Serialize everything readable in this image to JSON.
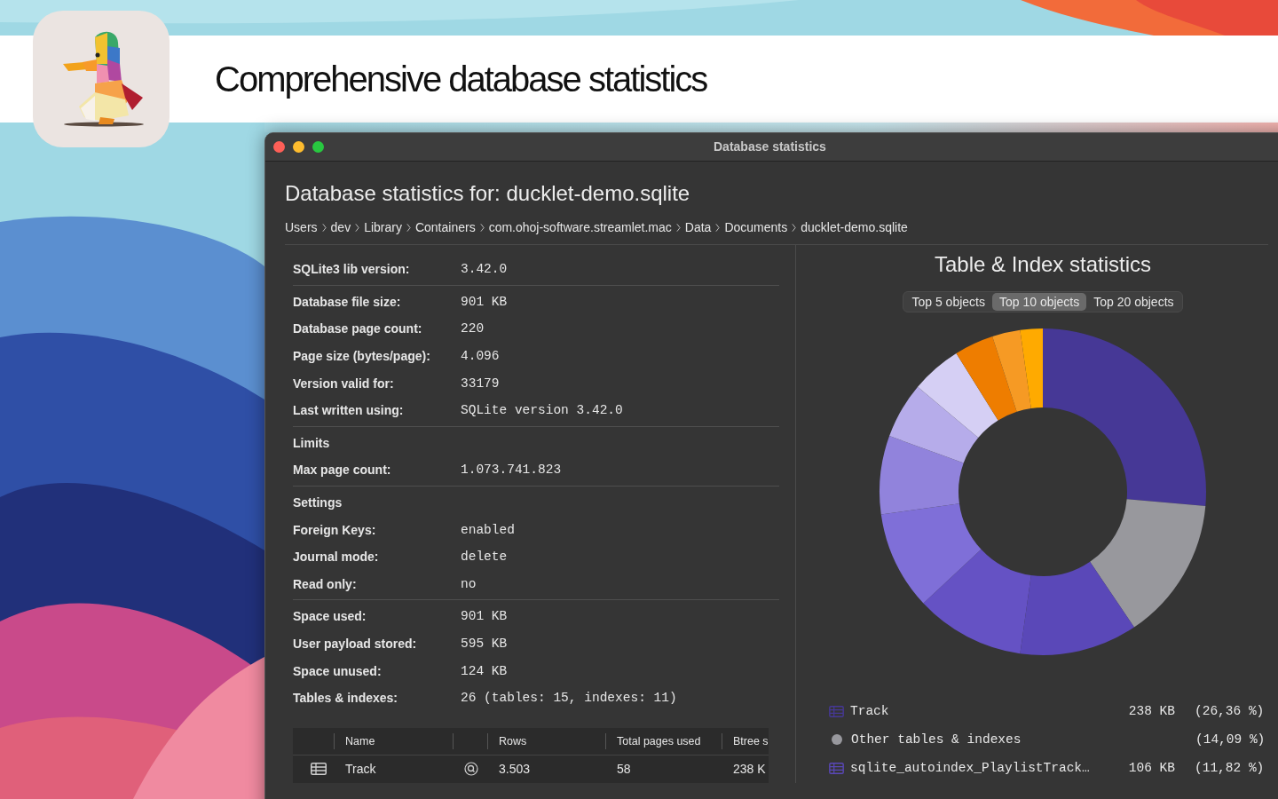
{
  "headline": "Comprehensive database statistics",
  "window": {
    "title": "Database statistics"
  },
  "heading": "Database statistics for: ducklet-demo.sqlite",
  "breadcrumb": [
    "Users",
    "dev",
    "Library",
    "Containers",
    "com.ohoj-software.streamlet.mac",
    "Data",
    "Documents",
    "ducklet-demo.sqlite"
  ],
  "sections": [
    {
      "rows": [
        {
          "label": "SQLite3 lib version:",
          "value": "3.42.0"
        }
      ]
    },
    {
      "rows": [
        {
          "label": "Database file size:",
          "value": "901 KB"
        },
        {
          "label": "Database page count:",
          "value": "220"
        },
        {
          "label": "Page size (bytes/page):",
          "value": "4.096"
        },
        {
          "label": "Version valid for:",
          "value": "33179"
        },
        {
          "label": "Last written using:",
          "value": "SQLite version 3.42.0"
        }
      ]
    },
    {
      "heading": "Limits",
      "rows": [
        {
          "label": "Max page count:",
          "value": "1.073.741.823"
        }
      ]
    },
    {
      "heading": "Settings",
      "rows": [
        {
          "label": "Foreign Keys:",
          "value": "enabled"
        },
        {
          "label": "Journal mode:",
          "value": "delete"
        },
        {
          "label": "Read only:",
          "value": "no"
        }
      ]
    },
    {
      "rows": [
        {
          "label": "Space used:",
          "value": "901 KB"
        },
        {
          "label": "User payload stored:",
          "value": "595 KB"
        },
        {
          "label": "Space unused:",
          "value": "124 KB"
        },
        {
          "label": "Tables & indexes:",
          "value": "26 (tables: 15, indexes: 11)"
        }
      ]
    }
  ],
  "table": {
    "columns": [
      "Name",
      "Rows",
      "Total pages used",
      "Btree s"
    ],
    "rows": [
      {
        "name": "Track",
        "rows": "3.503",
        "pages": "58",
        "column_4": "238 K"
      }
    ]
  },
  "chart_panel": {
    "title": "Table & Index statistics",
    "segments": [
      {
        "label": "Top 5 objects",
        "selected": false
      },
      {
        "label": "Top 10 objects",
        "selected": true
      },
      {
        "label": "Top 20 objects",
        "selected": false
      }
    ],
    "legend": [
      {
        "kind": "table",
        "name": "Track",
        "size": "238 KB",
        "percent": "(26,36 %)",
        "color": "#463896"
      },
      {
        "kind": "other",
        "name": "Other tables & indexes",
        "percent": "(14,09 %)",
        "color": "#98989d"
      },
      {
        "kind": "table",
        "name": "sqlite_autoindex_PlaylistTrack…",
        "size": "106 KB",
        "percent": "(11,82 %)",
        "color": "#5a48b8"
      }
    ]
  }
}
